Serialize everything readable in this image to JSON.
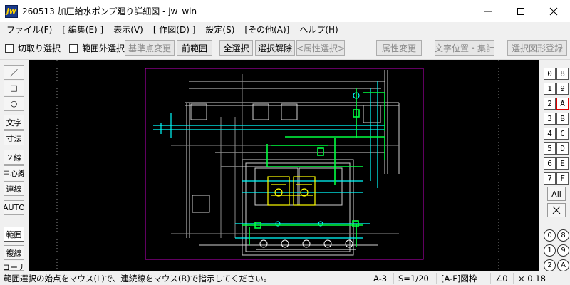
{
  "window": {
    "title": "260513 加圧給水ポンプ廻り詳細図 - jw_win",
    "icon_label": "jw"
  },
  "menu": [
    "ファイル(F)",
    "[ 編集(E) ]",
    "表示(V)",
    "[ 作図(D) ]",
    "設定(S)",
    "[その他(A)]",
    "ヘルプ(H)"
  ],
  "toolbar": {
    "cut_select": "切取り選択",
    "outside_select": "範囲外選択",
    "base_point": "基準点変更",
    "prev_range": "前範囲",
    "select_all": "全選択",
    "deselect": "選択解除",
    "attr_select": "<属性選択>",
    "attr_change": "属性変更",
    "text_pos": "文字位置・集計",
    "register_shape": "選択図形登録"
  },
  "left_tools": {
    "line": "／",
    "rect": "□",
    "circle": "○",
    "text": "文字",
    "dimension": "寸法",
    "double_line": "２線",
    "center_line": "中心線",
    "continuous_line": "連線",
    "auto": "AUTO",
    "range": "範囲",
    "copy_line": "複線",
    "corner": "コーナ"
  },
  "layers": {
    "left": [
      "0",
      "1",
      "2",
      "3",
      "4",
      "5",
      "6",
      "7"
    ],
    "right": [
      "8",
      "9",
      "A",
      "B",
      "C",
      "D",
      "E",
      "F"
    ],
    "all": "All",
    "groups_left": [
      "0",
      "1",
      "2"
    ],
    "groups_right": [
      "8",
      "9",
      "A"
    ]
  },
  "status": {
    "message": "範囲選択の始点をマウス(L)で、連続線をマウス(R)で指示してください。",
    "paper": "A-3",
    "scale": "S=1/20",
    "layer_group": "[A-F]図枠",
    "angle": "∠0",
    "zoom": "× 0.18"
  },
  "colors": {
    "frame": "#c000c0",
    "pipe_cyan": "#00ffff",
    "pipe_green": "#00ff40",
    "equipment_yellow": "#ffff00",
    "line_white": "#ffffff",
    "line_gray": "#9a9a9a"
  }
}
